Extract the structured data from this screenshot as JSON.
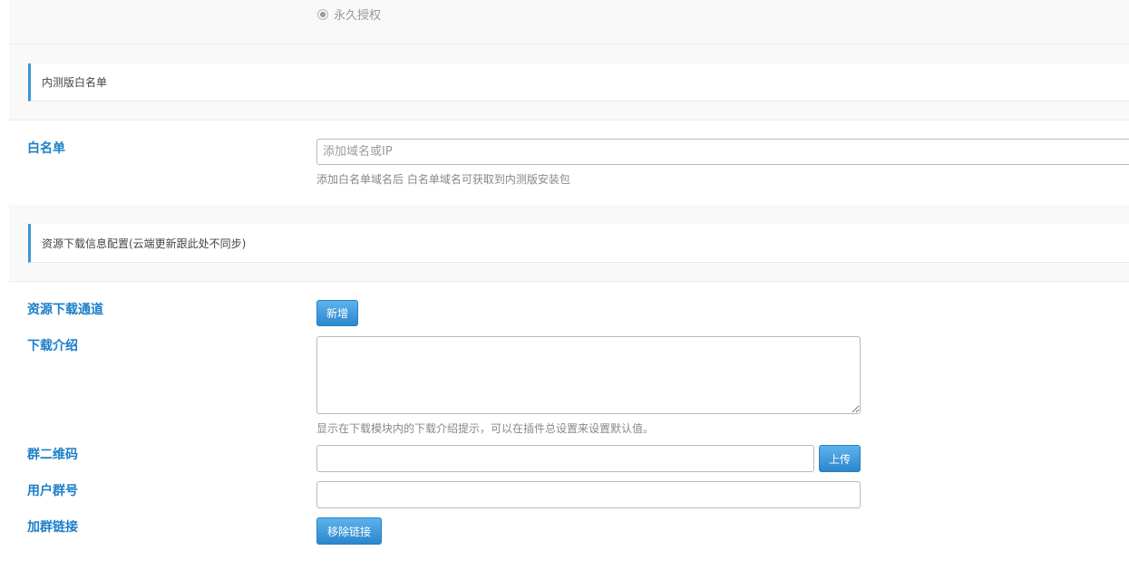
{
  "license": {
    "option_label": "永久授权",
    "selected": true
  },
  "whitelist_section": {
    "title": "内测版白名单",
    "field_label": "白名单",
    "input_placeholder": "添加域名或IP",
    "input_value": "",
    "hint": "添加白名单域名后 白名单域名可获取到内测版安装包"
  },
  "resource_section": {
    "title": "资源下载信息配置(云端更新跟此处不同步)",
    "download_channel": {
      "label": "资源下载通道",
      "add_button": "新增"
    },
    "download_intro": {
      "label": "下载介绍",
      "value": "",
      "hint": "显示在下载模块内的下载介绍提示，可以在插件总设置来设置默认值。"
    },
    "group_qrcode": {
      "label": "群二维码",
      "value": "",
      "upload_button": "上传"
    },
    "user_group_number": {
      "label": "用户群号",
      "value": ""
    },
    "join_group_link": {
      "label": "加群链接",
      "remove_button": "移除链接"
    }
  },
  "colors": {
    "accent": "#3c97d6",
    "label_blue": "#1b7fc8",
    "button_top": "#5cb3ec",
    "button_bottom": "#2b86cc"
  }
}
